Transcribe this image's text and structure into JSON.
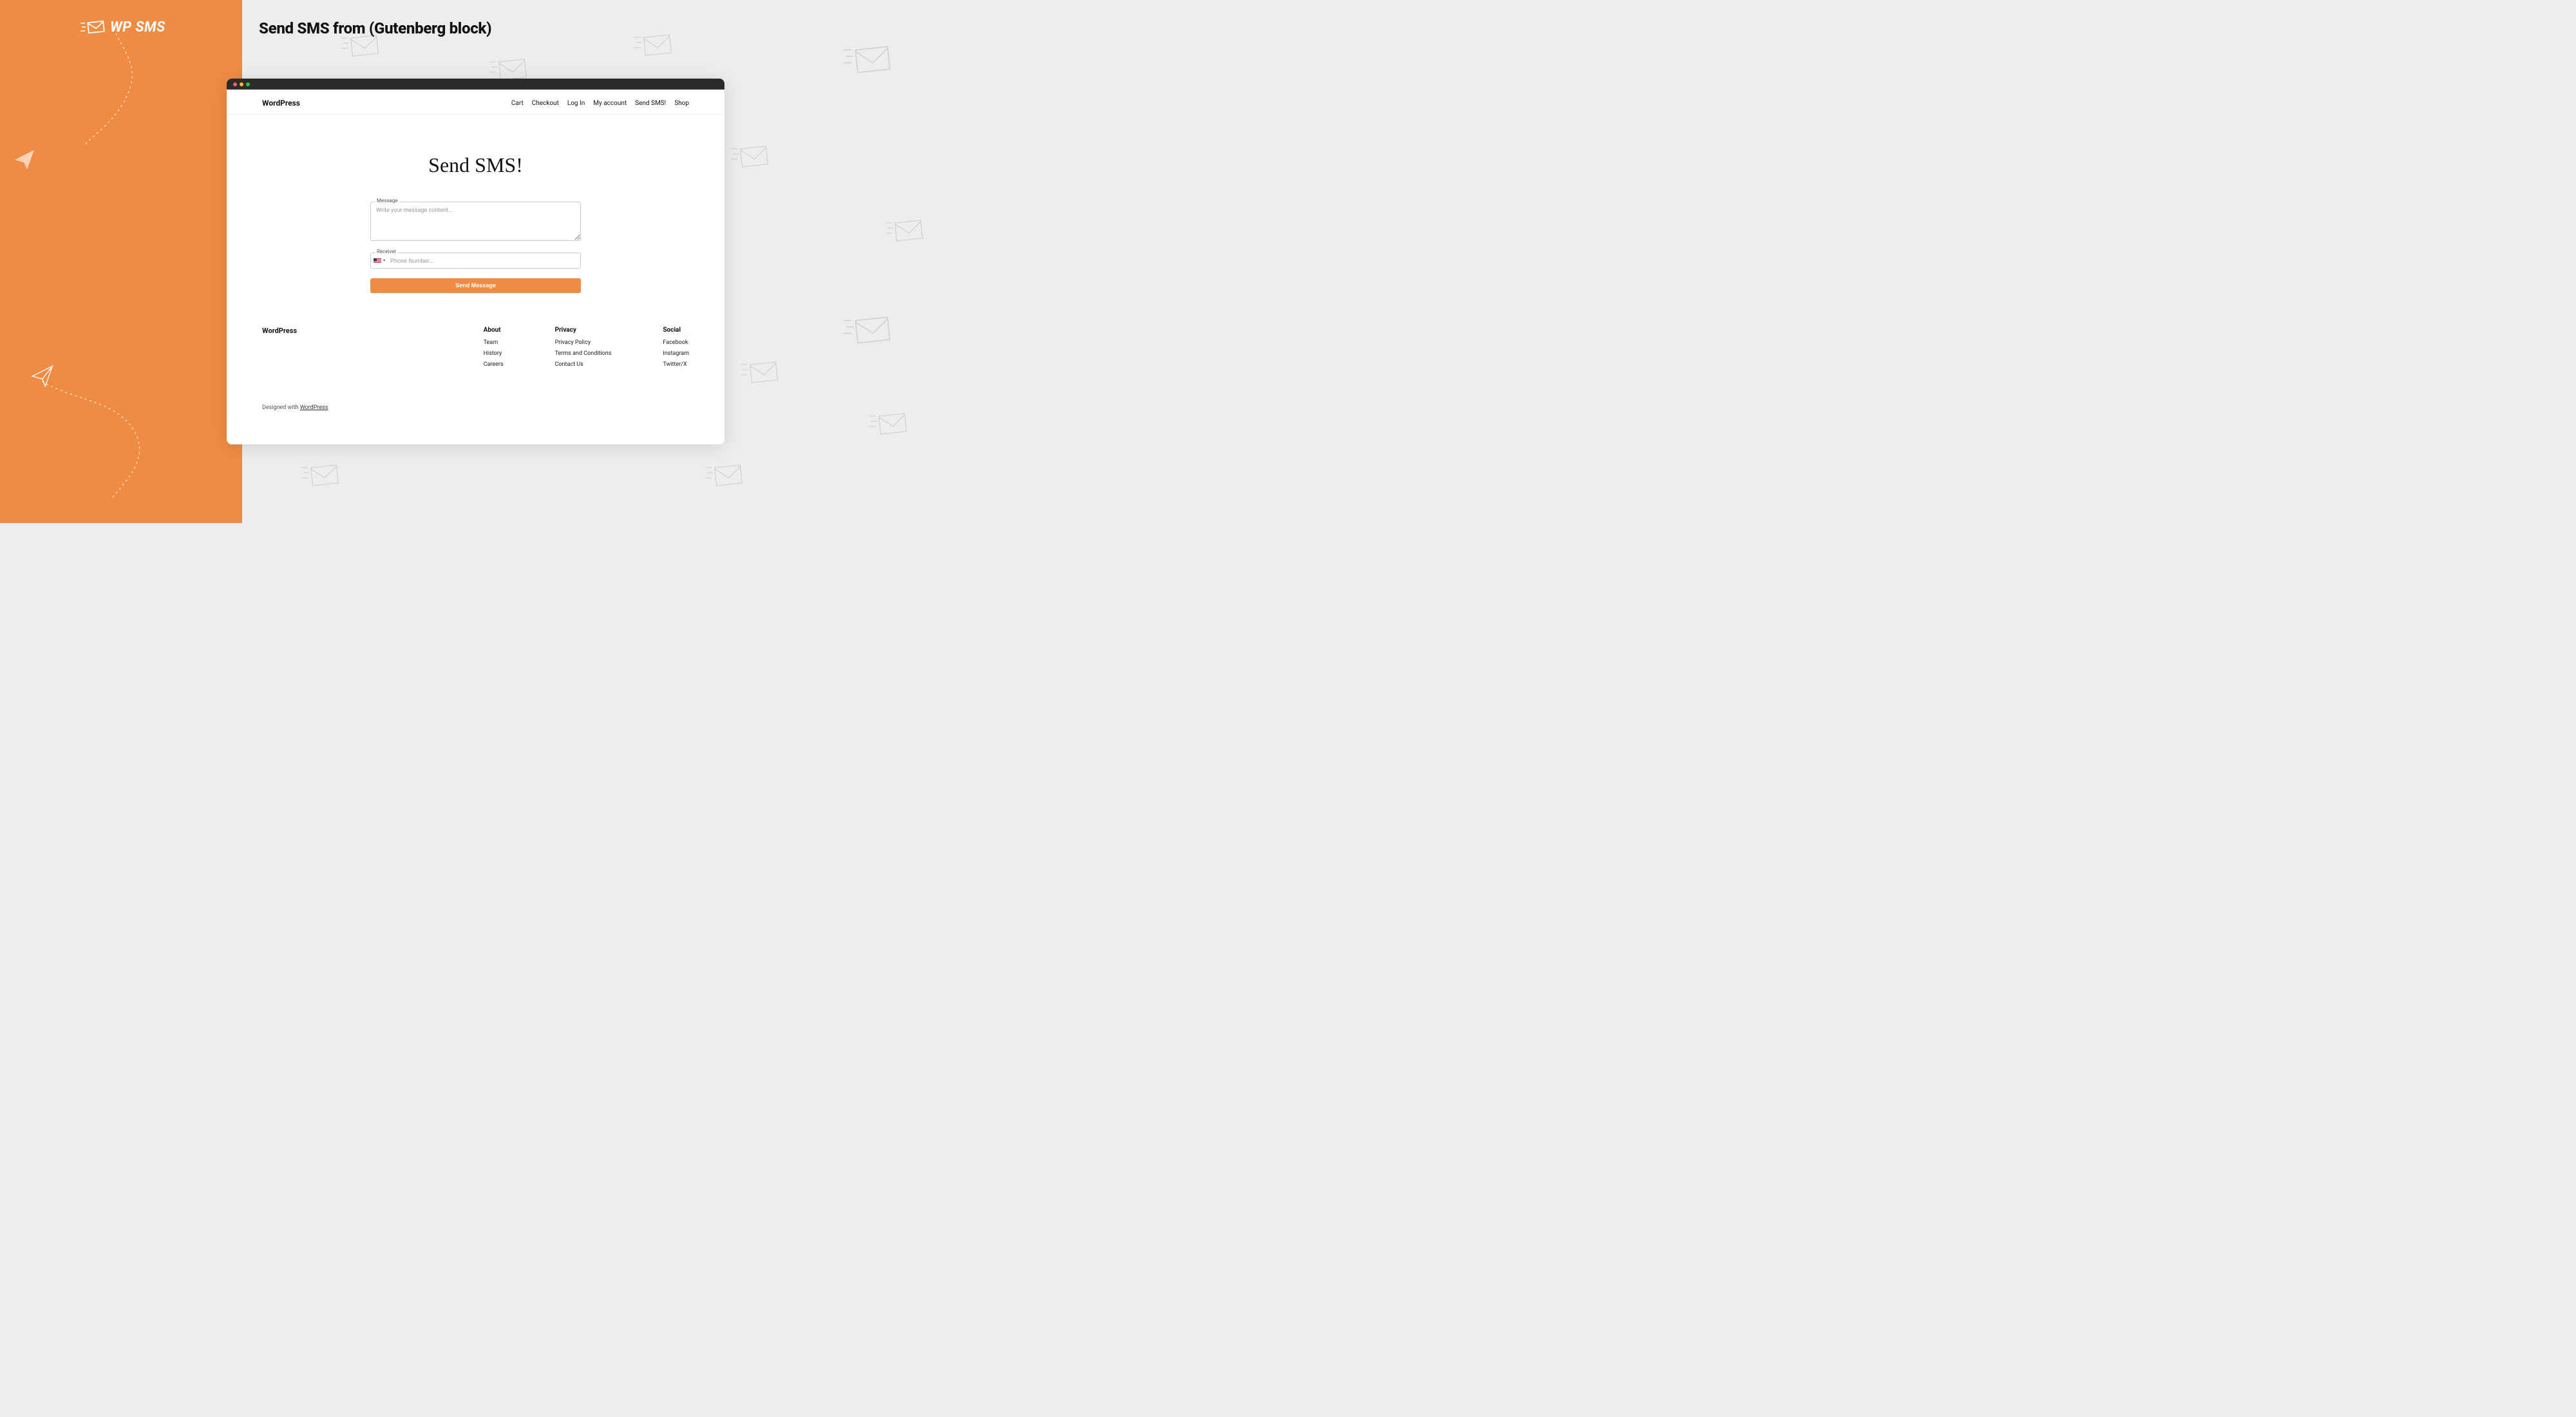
{
  "brand": {
    "name": "WP SMS"
  },
  "page_heading": "Send SMS from (Gutenberg block)",
  "browser": {
    "site_title": "WordPress",
    "nav": [
      {
        "label": "Cart"
      },
      {
        "label": "Checkout"
      },
      {
        "label": "Log In"
      },
      {
        "label": "My account"
      },
      {
        "label": "Send SMS!"
      },
      {
        "label": "Shop"
      }
    ],
    "page_title": "Send SMS!",
    "form": {
      "message_label": "Message",
      "message_placeholder": "Write your message content...",
      "receiver_label": "Receiver",
      "phone_placeholder": "Phone Number...",
      "country_code_selected": "US",
      "submit_label": "Send Message"
    },
    "footer": {
      "brand": "WordPress",
      "columns": [
        {
          "heading": "About",
          "links": [
            "Team",
            "History",
            "Careers"
          ]
        },
        {
          "heading": "Privacy",
          "links": [
            "Privacy Policy",
            "Terms and Conditions",
            "Contact Us"
          ]
        },
        {
          "heading": "Social",
          "links": [
            "Facebook",
            "Instagram",
            "Twitter/X"
          ]
        }
      ],
      "credit_prefix": "Designed with ",
      "credit_link": "WordPress"
    }
  },
  "colors": {
    "accent": "#f08b43"
  }
}
